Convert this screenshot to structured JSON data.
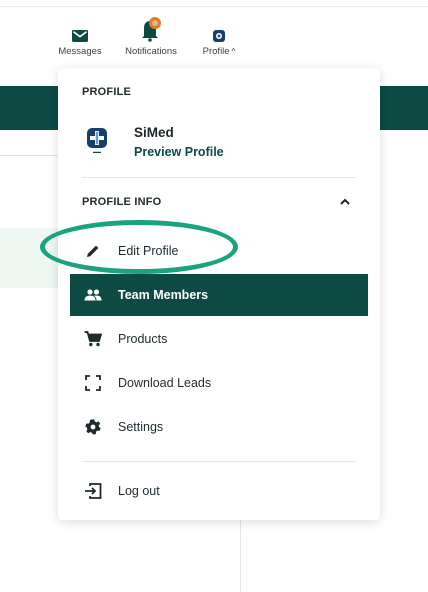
{
  "topnav": {
    "messages_label": "Messages",
    "notifications_label": "Notifications",
    "profile_label": "Profile"
  },
  "dropdown": {
    "profile_heading": "PROFILE",
    "company_name": "SiMed",
    "preview_label": "Preview Profile",
    "profile_info_heading": "PROFILE INFO",
    "menu": [
      {
        "label": "Edit Profile",
        "icon": "pencil-icon"
      },
      {
        "label": "Team Members",
        "icon": "people-icon",
        "active": true
      },
      {
        "label": "Products",
        "icon": "cart-icon"
      },
      {
        "label": "Download Leads",
        "icon": "crop-corners-icon"
      },
      {
        "label": "Settings",
        "icon": "gear-icon"
      }
    ],
    "logout_label": "Log out"
  },
  "colors": {
    "brand": "#0d4a44",
    "annotation": "#1aa37e",
    "notification_badge": "#e07a2e"
  }
}
